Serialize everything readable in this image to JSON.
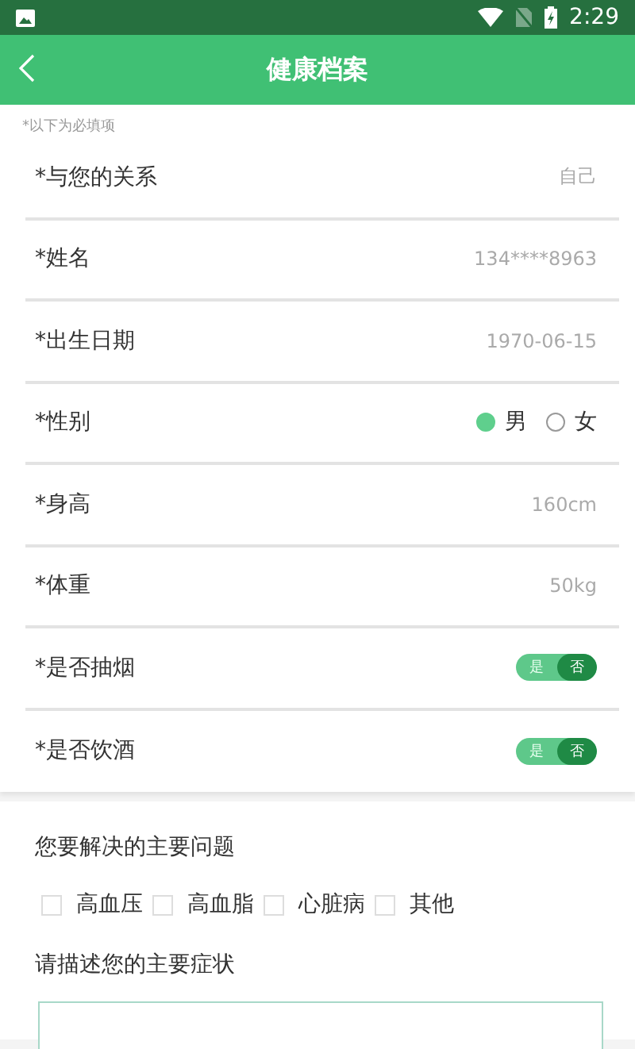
{
  "status_bar": {
    "time": "2:29"
  },
  "header": {
    "title": "健康档案"
  },
  "note": "*以下为必填项",
  "fields": [
    {
      "kind": "value",
      "label": "*与您的关系",
      "value": "自己"
    },
    {
      "kind": "value",
      "label": "*姓名",
      "value": "134****8963"
    },
    {
      "kind": "value",
      "label": "*出生日期",
      "value": "1970-06-15"
    },
    {
      "kind": "radio",
      "label": "*性别",
      "options": [
        {
          "label": "男",
          "selected": true
        },
        {
          "label": "女",
          "selected": false
        }
      ]
    },
    {
      "kind": "value",
      "label": "*身高",
      "value": "160cm"
    },
    {
      "kind": "value",
      "label": "*体重",
      "value": "50kg"
    },
    {
      "kind": "toggle",
      "label": "*是否抽烟",
      "options": [
        {
          "label": "是",
          "selected": false
        },
        {
          "label": "否",
          "selected": true
        }
      ]
    },
    {
      "kind": "toggle",
      "label": "*是否饮酒",
      "options": [
        {
          "label": "是",
          "selected": false
        },
        {
          "label": "否",
          "selected": true
        }
      ]
    }
  ],
  "problems": {
    "title": "您要解决的主要问题",
    "options": [
      {
        "label": "高血压",
        "checked": false
      },
      {
        "label": "高血脂",
        "checked": false
      },
      {
        "label": "心脏病",
        "checked": false
      },
      {
        "label": "其他",
        "checked": false
      }
    ]
  },
  "symptoms": {
    "title": "请描述您的主要症状"
  }
}
